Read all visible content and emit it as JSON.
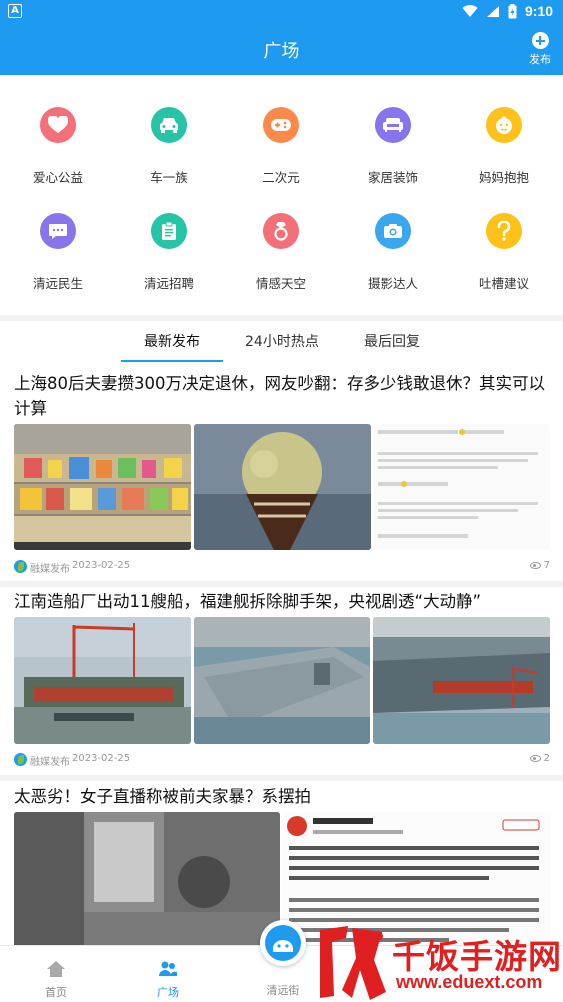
{
  "status_bar": {
    "time": "9:10",
    "notification_badge": "A"
  },
  "header": {
    "title": "广场",
    "publish_label": "发布"
  },
  "categories": [
    {
      "label": "爱心公益",
      "icon": "heart-icon",
      "color": "#f36f7a"
    },
    {
      "label": "车一族",
      "icon": "car-icon",
      "color": "#25c4a6"
    },
    {
      "label": "二次元",
      "icon": "gamepad-icon",
      "color": "#fb8a4a"
    },
    {
      "label": "家居装饰",
      "icon": "sofa-icon",
      "color": "#8874ec"
    },
    {
      "label": "妈妈抱抱",
      "icon": "baby-icon",
      "color": "#fcc21a"
    },
    {
      "label": "清远民生",
      "icon": "chat-icon",
      "color": "#8a74ea"
    },
    {
      "label": "清远招聘",
      "icon": "document-icon",
      "color": "#25c4a6"
    },
    {
      "label": "情感天空",
      "icon": "ring-icon",
      "color": "#f36f7a"
    },
    {
      "label": "摄影达人",
      "icon": "camera-icon",
      "color": "#39a7ef"
    },
    {
      "label": "吐槽建议",
      "icon": "question-icon",
      "color": "#fcc21a"
    }
  ],
  "tabs": [
    {
      "label": "最新发布",
      "active": true
    },
    {
      "label": "24小时热点",
      "active": false
    },
    {
      "label": "最后回复",
      "active": false
    }
  ],
  "articles": [
    {
      "title": "上海80后夫妻攒300万决定退休，网友吵翻：存多少钱敢退休？其实可以计算",
      "source": "融媒发布",
      "date": "2023-02-25",
      "views": "7"
    },
    {
      "title": "江南造船厂出动11艘船，福建舰拆除脚手架，央视剧透“大动静”",
      "source": "融媒发布",
      "date": "2023-02-25",
      "views": "2"
    },
    {
      "title": "太恶劣！女子直播称被前夫家暴？系摆拍"
    }
  ],
  "bottom_nav": [
    {
      "label": "首页",
      "icon": "home-icon",
      "active": false
    },
    {
      "label": "广场",
      "icon": "people-icon",
      "active": true
    },
    {
      "label": "清远街",
      "icon": "mascot-icon",
      "active": false
    }
  ],
  "watermark": {
    "text": "千饭手游网",
    "url": "www.eduext.com"
  },
  "colors": {
    "brand": "#1e9bf0",
    "watermark": "#e02020"
  }
}
